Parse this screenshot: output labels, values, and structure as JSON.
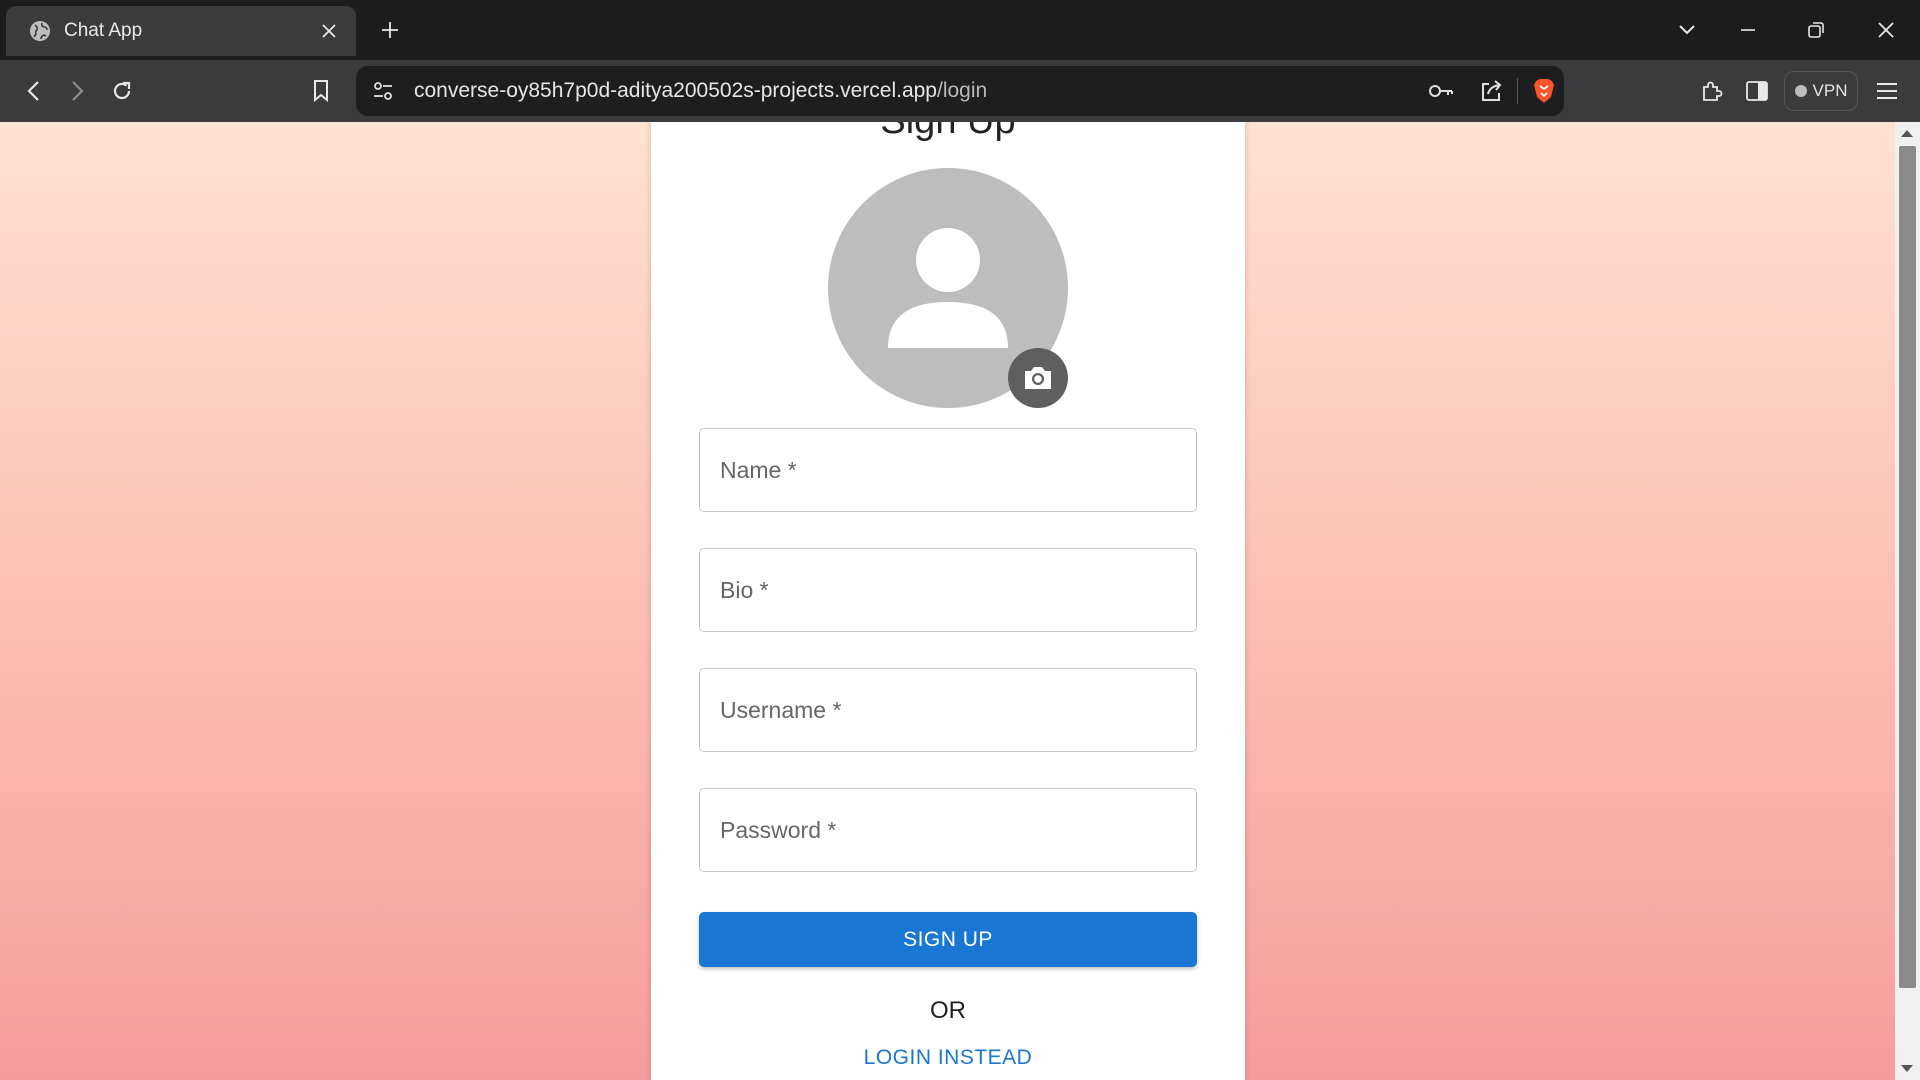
{
  "browser": {
    "tab_title": "Chat App",
    "url_host": "converse-oy85h7p0d-aditya200502s-projects.vercel.app",
    "url_path": "/login",
    "vpn_label": "VPN"
  },
  "form": {
    "title": "Sign Up",
    "fields": {
      "name": "Name *",
      "bio": "Bio *",
      "username": "Username *",
      "password": "Password *"
    },
    "signup_button": "SIGN UP",
    "divider": "OR",
    "login_link": "LOGIN INSTEAD"
  },
  "colors": {
    "primary": "#1976d2",
    "background_top": "#ffe1d2",
    "background_bottom": "#f79c9c",
    "avatar_bg": "#bdbdbd"
  },
  "icons": [
    "globe-icon",
    "close-icon",
    "plus-icon",
    "chevron-down-icon",
    "minimize-icon",
    "restore-icon",
    "back-icon",
    "forward-icon",
    "reload-icon",
    "bookmark-icon",
    "site-settings-icon",
    "key-icon",
    "share-icon",
    "brave-shield-icon",
    "extensions-icon",
    "sidebar-icon",
    "menu-icon",
    "person-icon",
    "camera-icon"
  ]
}
